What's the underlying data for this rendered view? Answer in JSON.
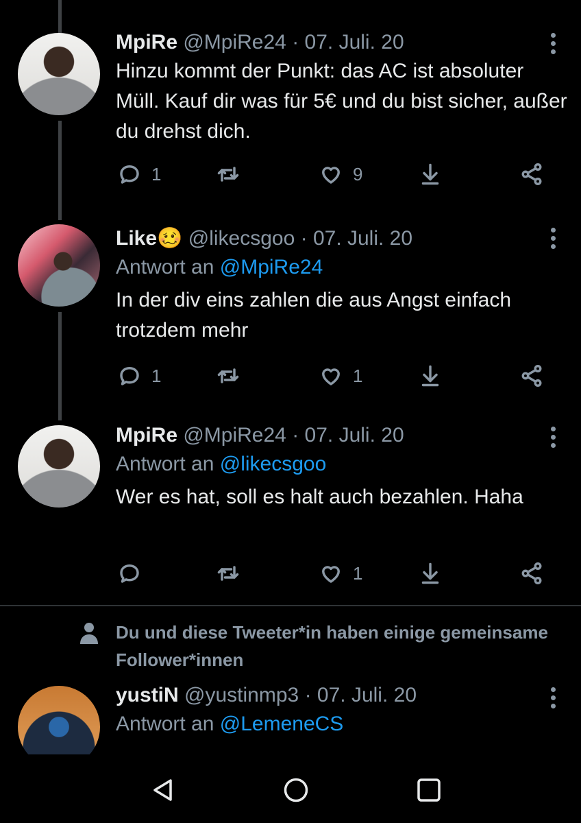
{
  "tweets": [
    {
      "name": "MpiRe",
      "emoji": "",
      "handle": "@MpiRe24",
      "separator": "·",
      "date": "07. Juli. 20",
      "reply_prefix": "",
      "reply_to": "",
      "text": "Hinzu kommt der Punkt: das AC ist absoluter Müll. Kauf dir was für 5€ und du bist sicher, außer du drehst dich.",
      "replies": "1",
      "retweets": "",
      "likes": "9"
    },
    {
      "name": "Like",
      "emoji": "🥴",
      "handle": "@likecsgoo",
      "separator": "·",
      "date": "07. Juli. 20",
      "reply_prefix": "Antwort an",
      "reply_to": "@MpiRe24",
      "text": "In der div eins zahlen die aus Angst einfach trotzdem mehr",
      "replies": "1",
      "retweets": "",
      "likes": "1"
    },
    {
      "name": "MpiRe",
      "emoji": "",
      "handle": "@MpiRe24",
      "separator": "·",
      "date": "07. Juli. 20",
      "reply_prefix": "Antwort an",
      "reply_to": "@likecsgoo",
      "text": "Wer es hat, soll es halt auch bezahlen. Haha",
      "replies": "",
      "retweets": "",
      "likes": "1"
    },
    {
      "name": "yustiN",
      "emoji": "",
      "handle": "@yustinmp3",
      "separator": "·",
      "date": "07. Juli. 20",
      "reply_prefix": "Antwort an",
      "reply_to": "@LemeneCS",
      "text": "",
      "replies": "",
      "retweets": "",
      "likes": ""
    }
  ],
  "notice": {
    "text": "Du und diese Tweeter*in haben einige gemeinsame Follower*innen",
    "icon": "person-icon"
  },
  "icons": {
    "reply": "reply-icon",
    "retweet": "retweet-icon",
    "like": "heart-icon",
    "download": "download-icon",
    "share": "share-icon",
    "more": "more-options-icon"
  },
  "navigation": [
    "back-icon",
    "home-icon",
    "recents-icon"
  ],
  "colors": {
    "background": "#000000",
    "text": "#e7e9ea",
    "muted": "#8b98a5",
    "link": "#1d9bf0"
  }
}
